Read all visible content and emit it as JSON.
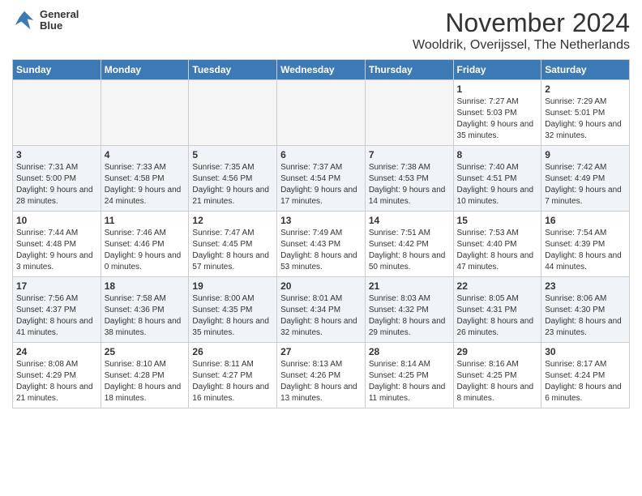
{
  "header": {
    "logo": {
      "line1": "General",
      "line2": "Blue"
    },
    "title": "November 2024",
    "subtitle": "Wooldrik, Overijssel, The Netherlands"
  },
  "weekdays": [
    "Sunday",
    "Monday",
    "Tuesday",
    "Wednesday",
    "Thursday",
    "Friday",
    "Saturday"
  ],
  "weeks": [
    [
      {
        "day": "",
        "info": ""
      },
      {
        "day": "",
        "info": ""
      },
      {
        "day": "",
        "info": ""
      },
      {
        "day": "",
        "info": ""
      },
      {
        "day": "",
        "info": ""
      },
      {
        "day": "1",
        "info": "Sunrise: 7:27 AM\nSunset: 5:03 PM\nDaylight: 9 hours and 35 minutes."
      },
      {
        "day": "2",
        "info": "Sunrise: 7:29 AM\nSunset: 5:01 PM\nDaylight: 9 hours and 32 minutes."
      }
    ],
    [
      {
        "day": "3",
        "info": "Sunrise: 7:31 AM\nSunset: 5:00 PM\nDaylight: 9 hours and 28 minutes."
      },
      {
        "day": "4",
        "info": "Sunrise: 7:33 AM\nSunset: 4:58 PM\nDaylight: 9 hours and 24 minutes."
      },
      {
        "day": "5",
        "info": "Sunrise: 7:35 AM\nSunset: 4:56 PM\nDaylight: 9 hours and 21 minutes."
      },
      {
        "day": "6",
        "info": "Sunrise: 7:37 AM\nSunset: 4:54 PM\nDaylight: 9 hours and 17 minutes."
      },
      {
        "day": "7",
        "info": "Sunrise: 7:38 AM\nSunset: 4:53 PM\nDaylight: 9 hours and 14 minutes."
      },
      {
        "day": "8",
        "info": "Sunrise: 7:40 AM\nSunset: 4:51 PM\nDaylight: 9 hours and 10 minutes."
      },
      {
        "day": "9",
        "info": "Sunrise: 7:42 AM\nSunset: 4:49 PM\nDaylight: 9 hours and 7 minutes."
      }
    ],
    [
      {
        "day": "10",
        "info": "Sunrise: 7:44 AM\nSunset: 4:48 PM\nDaylight: 9 hours and 3 minutes."
      },
      {
        "day": "11",
        "info": "Sunrise: 7:46 AM\nSunset: 4:46 PM\nDaylight: 9 hours and 0 minutes."
      },
      {
        "day": "12",
        "info": "Sunrise: 7:47 AM\nSunset: 4:45 PM\nDaylight: 8 hours and 57 minutes."
      },
      {
        "day": "13",
        "info": "Sunrise: 7:49 AM\nSunset: 4:43 PM\nDaylight: 8 hours and 53 minutes."
      },
      {
        "day": "14",
        "info": "Sunrise: 7:51 AM\nSunset: 4:42 PM\nDaylight: 8 hours and 50 minutes."
      },
      {
        "day": "15",
        "info": "Sunrise: 7:53 AM\nSunset: 4:40 PM\nDaylight: 8 hours and 47 minutes."
      },
      {
        "day": "16",
        "info": "Sunrise: 7:54 AM\nSunset: 4:39 PM\nDaylight: 8 hours and 44 minutes."
      }
    ],
    [
      {
        "day": "17",
        "info": "Sunrise: 7:56 AM\nSunset: 4:37 PM\nDaylight: 8 hours and 41 minutes."
      },
      {
        "day": "18",
        "info": "Sunrise: 7:58 AM\nSunset: 4:36 PM\nDaylight: 8 hours and 38 minutes."
      },
      {
        "day": "19",
        "info": "Sunrise: 8:00 AM\nSunset: 4:35 PM\nDaylight: 8 hours and 35 minutes."
      },
      {
        "day": "20",
        "info": "Sunrise: 8:01 AM\nSunset: 4:34 PM\nDaylight: 8 hours and 32 minutes."
      },
      {
        "day": "21",
        "info": "Sunrise: 8:03 AM\nSunset: 4:32 PM\nDaylight: 8 hours and 29 minutes."
      },
      {
        "day": "22",
        "info": "Sunrise: 8:05 AM\nSunset: 4:31 PM\nDaylight: 8 hours and 26 minutes."
      },
      {
        "day": "23",
        "info": "Sunrise: 8:06 AM\nSunset: 4:30 PM\nDaylight: 8 hours and 23 minutes."
      }
    ],
    [
      {
        "day": "24",
        "info": "Sunrise: 8:08 AM\nSunset: 4:29 PM\nDaylight: 8 hours and 21 minutes."
      },
      {
        "day": "25",
        "info": "Sunrise: 8:10 AM\nSunset: 4:28 PM\nDaylight: 8 hours and 18 minutes."
      },
      {
        "day": "26",
        "info": "Sunrise: 8:11 AM\nSunset: 4:27 PM\nDaylight: 8 hours and 16 minutes."
      },
      {
        "day": "27",
        "info": "Sunrise: 8:13 AM\nSunset: 4:26 PM\nDaylight: 8 hours and 13 minutes."
      },
      {
        "day": "28",
        "info": "Sunrise: 8:14 AM\nSunset: 4:25 PM\nDaylight: 8 hours and 11 minutes."
      },
      {
        "day": "29",
        "info": "Sunrise: 8:16 AM\nSunset: 4:25 PM\nDaylight: 8 hours and 8 minutes."
      },
      {
        "day": "30",
        "info": "Sunrise: 8:17 AM\nSunset: 4:24 PM\nDaylight: 8 hours and 6 minutes."
      }
    ]
  ]
}
